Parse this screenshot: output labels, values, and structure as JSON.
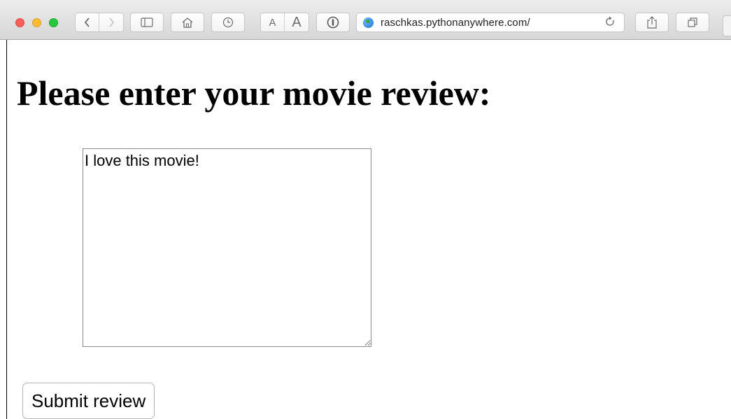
{
  "browser": {
    "url": "raschkas.pythonanywhere.com/",
    "text_size_small": "A",
    "text_size_large": "A",
    "icons": {
      "close": "red-close-dot",
      "minimize": "yellow-minimize-dot",
      "zoom": "green-zoom-dot",
      "back": "chevron-left-icon",
      "forward": "chevron-right-icon",
      "sidebar": "sidebar-icon",
      "home": "home-icon",
      "history": "clock-icon",
      "password": "one-password-icon",
      "site": "globe-icon",
      "reload": "reload-icon",
      "share": "share-icon",
      "tabs": "tabs-icon"
    }
  },
  "page": {
    "heading": "Please enter your movie review:",
    "review_text": "I love this movie!",
    "submit_label": "Submit review"
  }
}
